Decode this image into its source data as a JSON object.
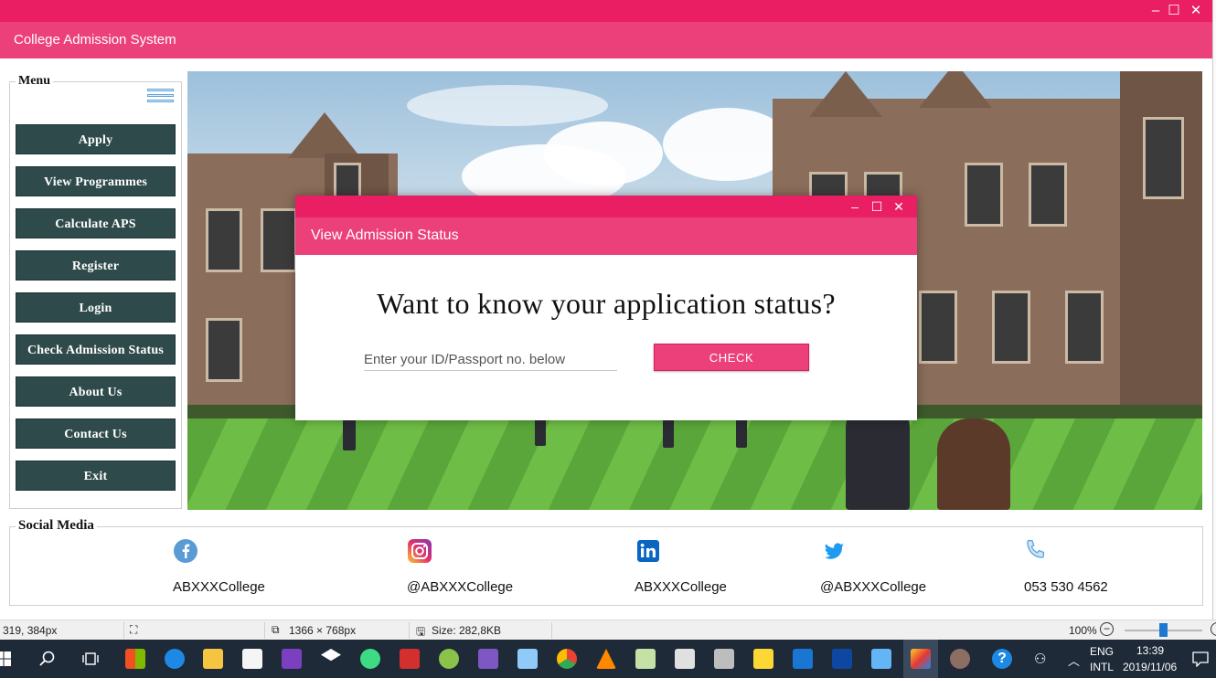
{
  "window": {
    "title": "College Admission System",
    "controls": {
      "minimize": "–",
      "maximize": "☐",
      "close": "✕"
    }
  },
  "menu": {
    "legend": "Menu",
    "items": [
      "Apply",
      "View Programmes",
      "Calculate APS",
      "Register",
      "Login",
      "Check Admission Status",
      "About Us",
      "Contact Us",
      "Exit"
    ]
  },
  "modal": {
    "title": "View Admission Status",
    "heading": "Want to know your application status?",
    "input_placeholder": "Enter your ID/Passport no. below",
    "check_label": "CHECK",
    "controls": {
      "minimize": "–",
      "maximize": "☐",
      "close": "✕"
    }
  },
  "social": {
    "legend": "Social Media",
    "items": [
      {
        "icon": "facebook-icon",
        "label": "ABXXXCollege",
        "color": "#3b5998"
      },
      {
        "icon": "instagram-icon",
        "label": "@ABXXXCollege",
        "color": "#e1306c"
      },
      {
        "icon": "linkedin-icon",
        "label": "ABXXXCollege",
        "color": "#0077b5"
      },
      {
        "icon": "twitter-icon",
        "label": "@ABXXXCollege",
        "color": "#1da1f2"
      },
      {
        "icon": "phone-icon",
        "label": "053 530 4562",
        "color": "#5ea4dc"
      }
    ]
  },
  "statusbar": {
    "cursor": "319, 384px",
    "dimensions": "1366 × 768px",
    "size": "Size: 282,8KB",
    "zoom": "100%"
  },
  "taskbar": {
    "lang_top": "ENG",
    "lang_bottom": "INTL",
    "time": "13:39",
    "date": "2019/11/06"
  },
  "colors": {
    "accent": "#e91e63",
    "header": "#ec407a",
    "menu_button": "#2e4a4a"
  }
}
